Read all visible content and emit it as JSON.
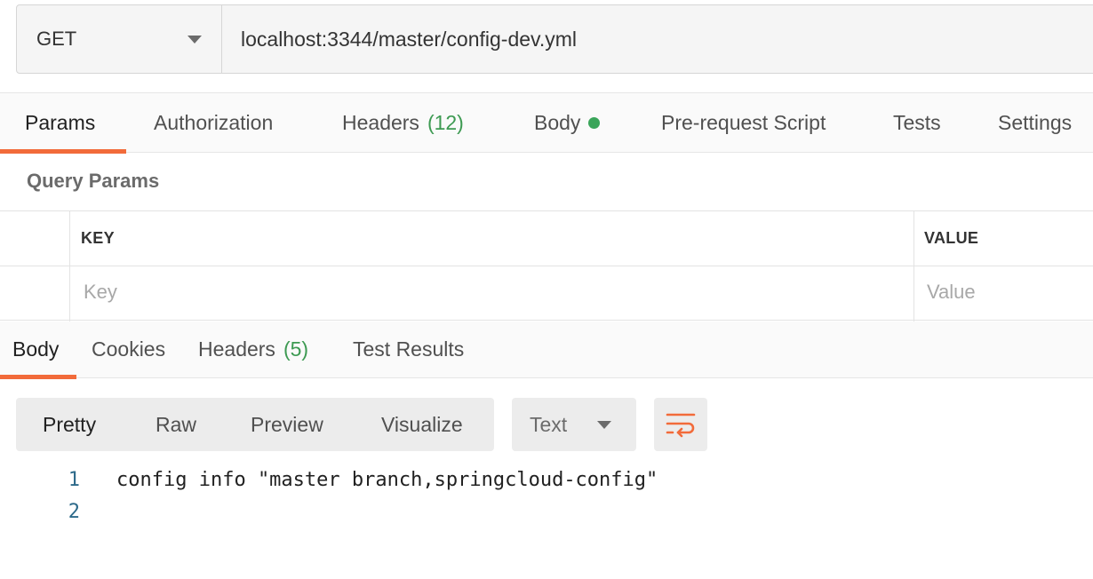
{
  "request": {
    "method": "GET",
    "url": "localhost:3344/master/config-dev.yml"
  },
  "request_tabs": [
    {
      "label": "Params",
      "active": true
    },
    {
      "label": "Authorization"
    },
    {
      "label": "Headers",
      "count": "(12)"
    },
    {
      "label": "Body",
      "indicator": "green-dot"
    },
    {
      "label": "Pre-request Script"
    },
    {
      "label": "Tests"
    },
    {
      "label": "Settings"
    }
  ],
  "query_params": {
    "title": "Query Params",
    "columns": [
      "KEY",
      "VALUE"
    ],
    "placeholders": {
      "key": "Key",
      "value": "Value"
    }
  },
  "response_tabs": [
    {
      "label": "Body",
      "active": true
    },
    {
      "label": "Cookies"
    },
    {
      "label": "Headers",
      "count": "(5)"
    },
    {
      "label": "Test Results"
    }
  ],
  "response_toolbar": {
    "formats": [
      "Pretty",
      "Raw",
      "Preview",
      "Visualize"
    ],
    "active_format": "Pretty",
    "type": "Text",
    "wrap_icon": "wrap-lines-icon"
  },
  "response_body": {
    "lines": [
      {
        "number": "1",
        "text": "config info \"master branch,springcloud-config\""
      },
      {
        "number": "2",
        "text": ""
      }
    ]
  },
  "colors": {
    "accent": "#f26b3a",
    "count_green": "#3d9a52",
    "dot_green": "#3aa55a"
  }
}
